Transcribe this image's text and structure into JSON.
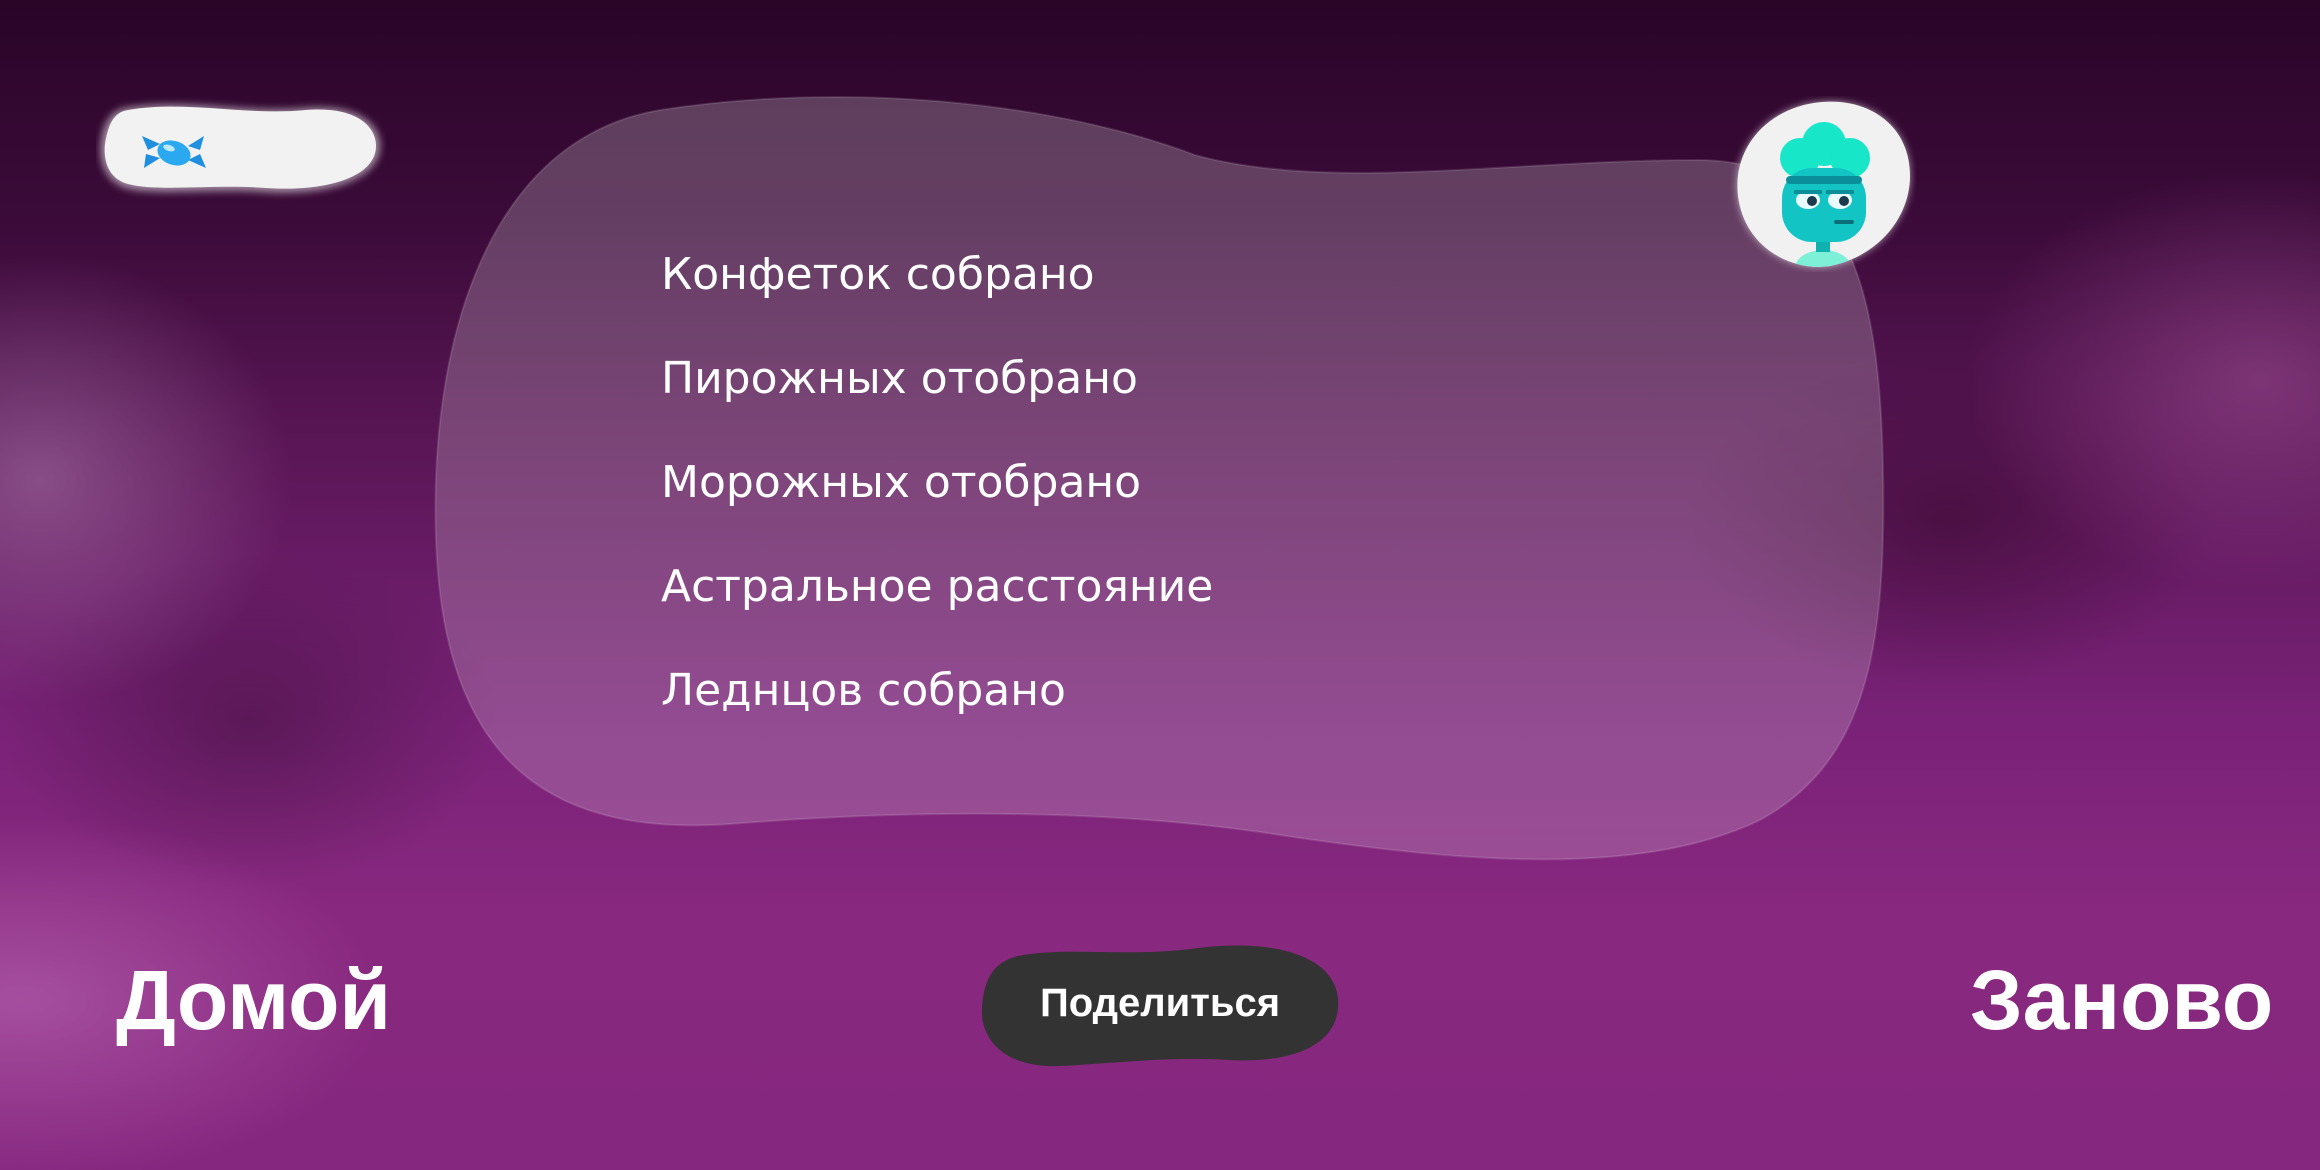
{
  "hud": {
    "candy_icon": "candy-icon",
    "candy_count": "",
    "avatar_icon": "chef-character-avatar"
  },
  "stats": [
    {
      "label": "Конфеток собрано",
      "value": ""
    },
    {
      "label": "Пирожных отобрано",
      "value": ""
    },
    {
      "label": "Морожных отобрано",
      "value": ""
    },
    {
      "label": "Астральное расстояние",
      "value": ""
    },
    {
      "label": "Леднцов собрано",
      "value": ""
    }
  ],
  "actions": {
    "home_label": "Домой",
    "share_label": "Поделиться",
    "restart_label": "Заново"
  },
  "colors": {
    "panel": "rgba(255,255,255,0.22)",
    "share_button": "#333333",
    "candy_blue": "#2aa8f0",
    "avatar_teal": "#12c4c4"
  }
}
